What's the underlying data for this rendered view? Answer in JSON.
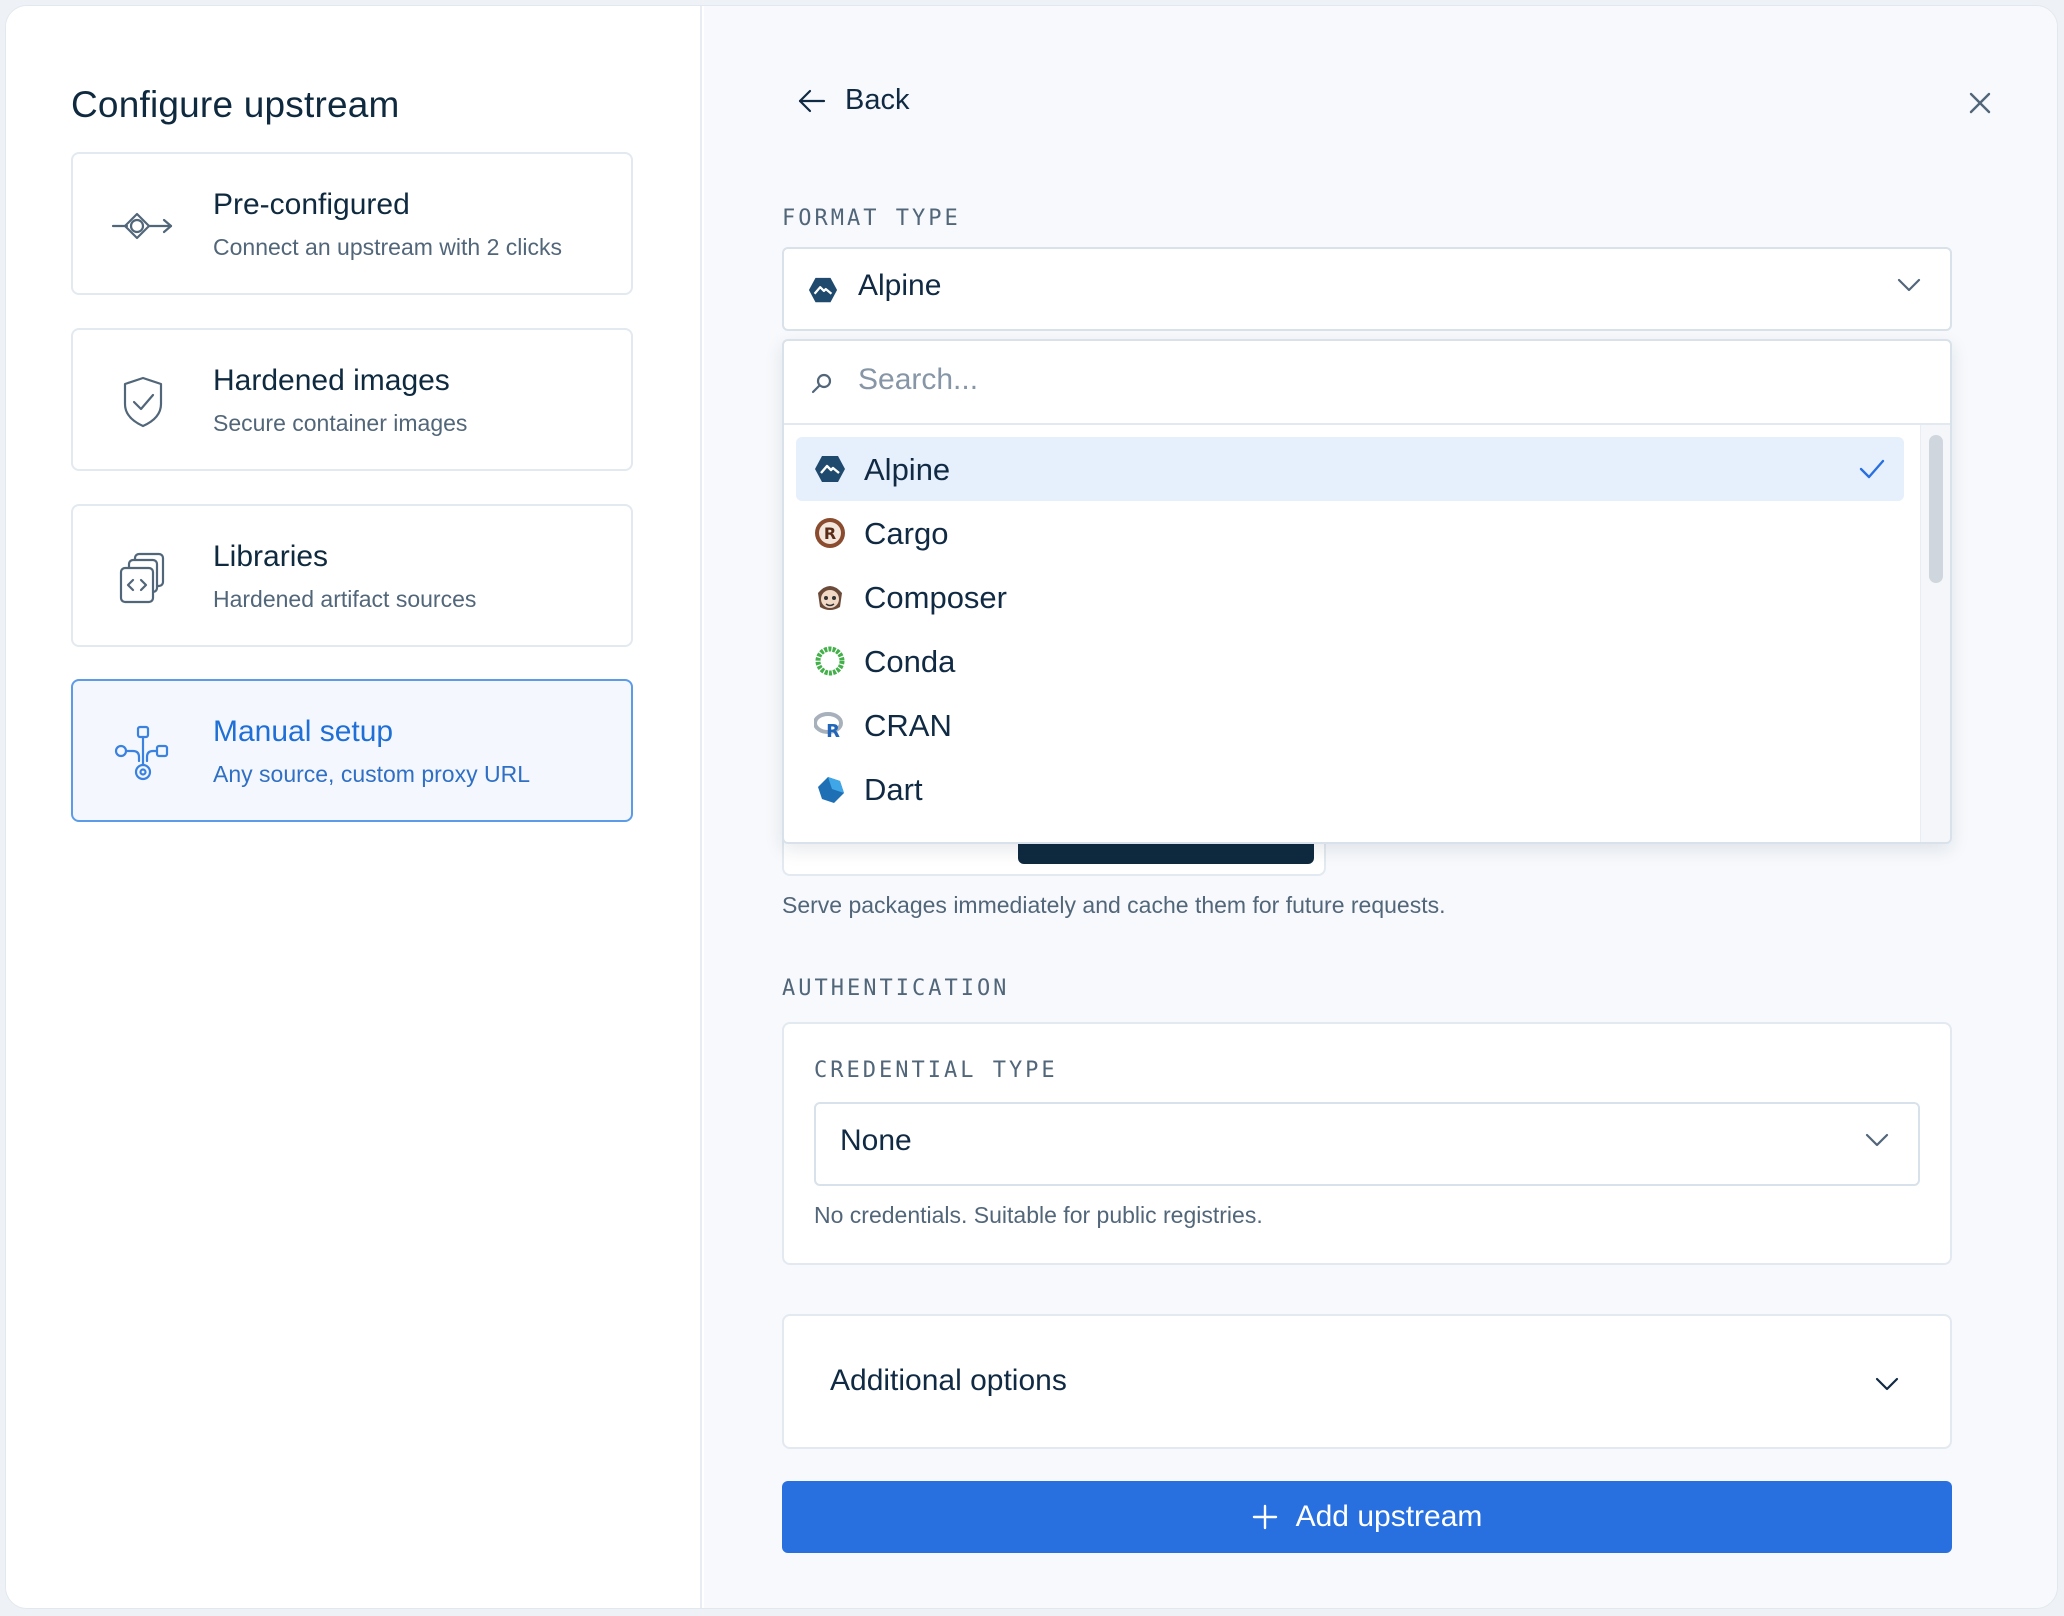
{
  "left_panel": {
    "title": "Configure upstream",
    "cards": [
      {
        "title": "Pre-configured",
        "subtitle": "Connect an upstream with 2 clicks",
        "icon": "connect-icon",
        "selected": false
      },
      {
        "title": "Hardened images",
        "subtitle": "Secure container images",
        "icon": "shield-check-icon",
        "selected": false
      },
      {
        "title": "Libraries",
        "subtitle": "Hardened artifact sources",
        "icon": "code-stack-icon",
        "selected": false
      },
      {
        "title": "Manual setup",
        "subtitle": "Any source, custom proxy URL",
        "icon": "network-node-icon",
        "selected": true
      }
    ]
  },
  "header": {
    "back_label": "Back",
    "back_icon": "arrow-left-icon",
    "close_icon": "close-icon"
  },
  "format": {
    "label": "FORMAT TYPE",
    "selected": "Alpine",
    "search_placeholder": "Search...",
    "options": [
      {
        "name": "Alpine",
        "icon": "alpine-logo-icon",
        "selected": true
      },
      {
        "name": "Cargo",
        "icon": "cargo-logo-icon",
        "selected": false
      },
      {
        "name": "Composer",
        "icon": "composer-logo-icon",
        "selected": false
      },
      {
        "name": "Conda",
        "icon": "conda-logo-icon",
        "selected": false
      },
      {
        "name": "CRAN",
        "icon": "cran-logo-icon",
        "selected": false
      },
      {
        "name": "Dart",
        "icon": "dart-logo-icon",
        "selected": false
      }
    ]
  },
  "cache_help": "Serve packages immediately and cache them for future requests.",
  "authentication": {
    "label": "AUTHENTICATION",
    "credential_label": "CREDENTIAL TYPE",
    "credential_value": "None",
    "credential_help": "No credentials. Suitable for public registries."
  },
  "additional_options": {
    "label": "Additional options"
  },
  "submit": {
    "label": "Add upstream",
    "icon": "plus-icon"
  },
  "colors": {
    "accent": "#2870e0",
    "text": "#102a43",
    "muted": "#52667a",
    "selected_bg": "#e6effc"
  }
}
